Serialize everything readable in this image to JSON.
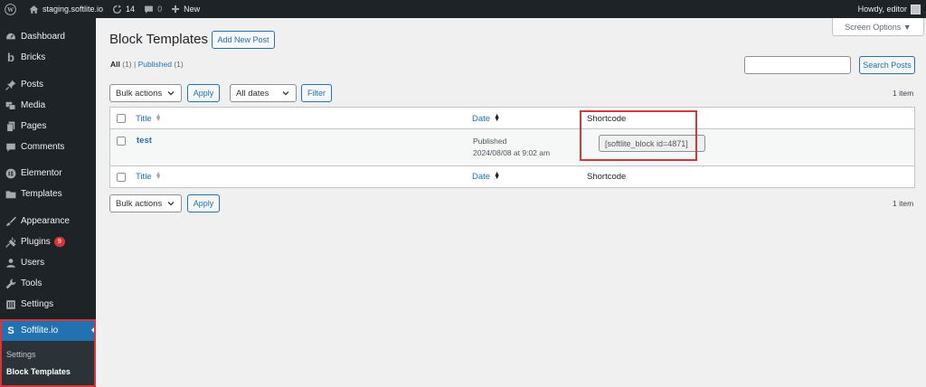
{
  "adminbar": {
    "site_name": "staging.softlite.io",
    "updates_count": "14",
    "comments_count": "0",
    "new_label": "New",
    "howdy": "Howdy, editor"
  },
  "sidebar": {
    "items": [
      {
        "label": "Dashboard",
        "icon": "dashboard-icon"
      },
      {
        "label": "Bricks",
        "icon": "bricks-icon"
      },
      {
        "label": "Posts",
        "icon": "pin-icon"
      },
      {
        "label": "Media",
        "icon": "media-icon"
      },
      {
        "label": "Pages",
        "icon": "pages-icon"
      },
      {
        "label": "Comments",
        "icon": "comment-icon"
      },
      {
        "label": "Elementor",
        "icon": "elementor-icon"
      },
      {
        "label": "Templates",
        "icon": "folder-icon"
      },
      {
        "label": "Appearance",
        "icon": "brush-icon"
      },
      {
        "label": "Plugins",
        "icon": "plug-icon",
        "badge": "9"
      },
      {
        "label": "Users",
        "icon": "user-icon"
      },
      {
        "label": "Tools",
        "icon": "wrench-icon"
      },
      {
        "label": "Settings",
        "icon": "settings-icon"
      },
      {
        "label": "Softlite.io",
        "icon": "softlite-icon",
        "active": true
      }
    ],
    "submenu": [
      {
        "label": "Settings"
      },
      {
        "label": "Block Templates",
        "current": true
      }
    ]
  },
  "page": {
    "title": "Block Templates",
    "add_new": "Add New Post",
    "screen_options": "Screen Options ▼",
    "views": {
      "all": "All",
      "all_count": "(1)",
      "sep": "|",
      "published": "Published",
      "published_count": "(1)"
    },
    "search_button": "Search Posts",
    "bulk_actions": "Bulk actions",
    "apply": "Apply",
    "all_dates": "All dates",
    "filter": "Filter",
    "items_count": "1 item"
  },
  "table": {
    "headers": {
      "title": "Title",
      "date": "Date",
      "shortcode": "Shortcode"
    },
    "rows": [
      {
        "title": "test",
        "status": "Published",
        "date": "2024/08/08 at 9:02 am",
        "shortcode": "[softlite_block id=4871]"
      }
    ]
  },
  "colors": {
    "accent": "#2271b1",
    "highlight": "#d63638",
    "sidebar": "#1d2327"
  }
}
